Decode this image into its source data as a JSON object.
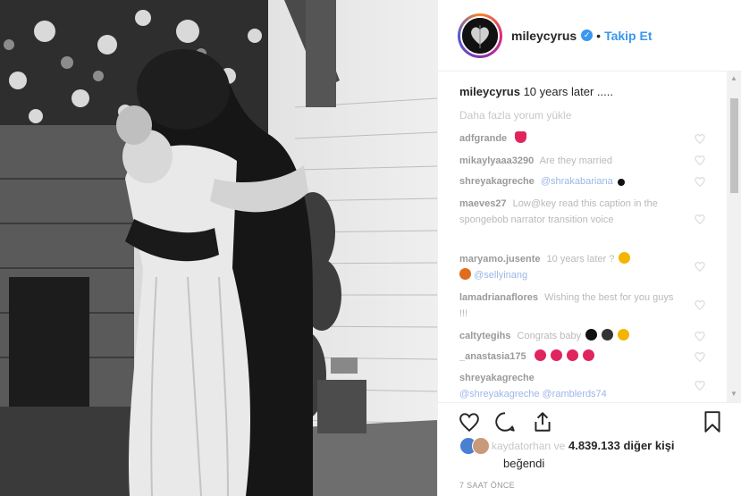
{
  "post": {
    "username": "mileycyrus",
    "verified_symbol": "✓",
    "separator": "•",
    "follow_label": "Takip Et",
    "caption_user": "mileycyrus",
    "caption_text": "10 years later .....",
    "load_more": "Daha fazla yorum yükle"
  },
  "comments": [
    {
      "user": "adfgrande",
      "text": "",
      "emoji": [
        "#e0245e"
      ]
    },
    {
      "user": "mikaylyaaa3290",
      "text": "Are they married",
      "emoji": []
    },
    {
      "user": "shreyakagreche",
      "mention": "@shrakabariana",
      "text": "",
      "emoji": [
        "#111111"
      ]
    },
    {
      "user": "maeves27",
      "text": "Low@key read this caption in the spongebob narrator transition voice",
      "emoji": []
    },
    {
      "user": "maryamo.jusente",
      "text": "10 years later ?",
      "mention": "@sellyinang",
      "emoji": [
        "#f4b400",
        "#e06c1e"
      ]
    },
    {
      "user": "lamadrianaflores",
      "text": "Wishing the best for you guys !!!",
      "emoji": []
    },
    {
      "user": "caltytegihs",
      "text": "Congrats baby",
      "emoji": [
        "#111111",
        "#333333",
        "#f4b400"
      ]
    },
    {
      "user": "_anastasia175",
      "text": "",
      "emoji": [
        "#e0245e",
        "#e0245e",
        "#e0245e",
        "#e0245e"
      ]
    },
    {
      "user": "shreyakagreche",
      "mention": "@shreyakagreche @ramblerds74",
      "text": "",
      "emoji": []
    }
  ],
  "likes": {
    "blurred_user": "kaydatorhan",
    "and_word": "ve",
    "count": "4.839.133",
    "suffix": "diğer kişi",
    "liked_word": "beğendi"
  },
  "timestamp": "7 SAAT ÖNCE",
  "icons": [
    "heart-icon",
    "comment-icon",
    "share-icon",
    "bookmark-icon",
    "verified-badge-icon"
  ],
  "colors": {
    "accent": "#3897f0",
    "heart": "#e0245e"
  }
}
